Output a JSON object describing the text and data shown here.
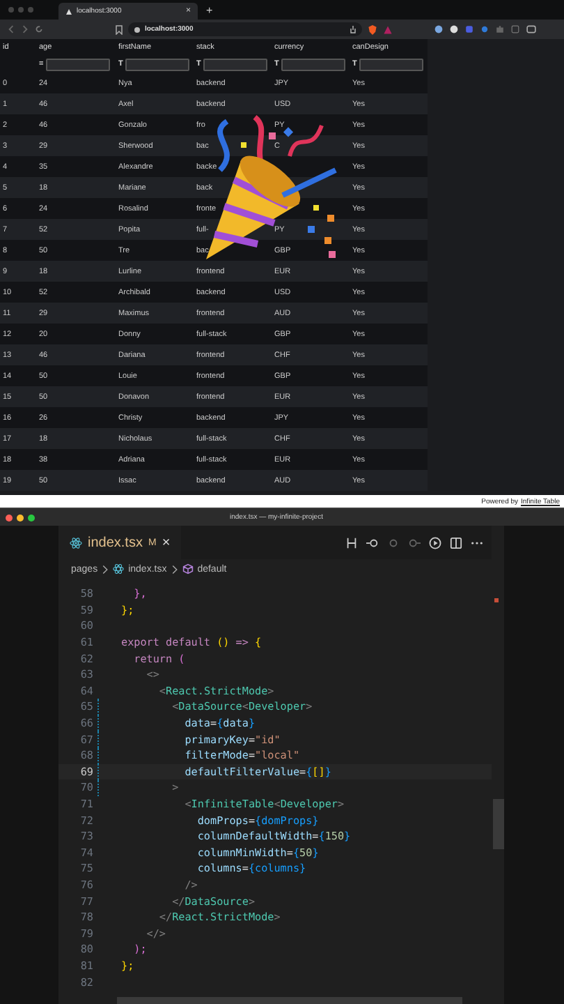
{
  "browser": {
    "tab_title": "localhost:3000",
    "tab_close": "×",
    "new_tab": "+",
    "address": "localhost:3000"
  },
  "table": {
    "columns": [
      "id",
      "age",
      "firstName",
      "stack",
      "currency",
      "canDesign"
    ],
    "filters": [
      {
        "operator": "="
      },
      {
        "operator": "T"
      },
      {
        "operator": "T"
      },
      {
        "operator": "T"
      },
      {
        "operator": "T"
      }
    ],
    "rows": [
      [
        "0",
        "24",
        "Nya",
        "backend",
        "JPY",
        "Yes"
      ],
      [
        "1",
        "46",
        "Axel",
        "backend",
        "USD",
        "Yes"
      ],
      [
        "2",
        "46",
        "Gonzalo",
        "fro",
        "PY",
        "Yes"
      ],
      [
        "3",
        "29",
        "Sherwood",
        "bac",
        "C",
        "Yes"
      ],
      [
        "4",
        "35",
        "Alexandre",
        "backe",
        null,
        "Yes"
      ],
      [
        "5",
        "18",
        "Mariane",
        "back",
        null,
        "Yes"
      ],
      [
        "6",
        "24",
        "Rosalind",
        "fronte",
        null,
        "Yes"
      ],
      [
        "7",
        "52",
        "Popita",
        "full-",
        "PY",
        "Yes"
      ],
      [
        "8",
        "50",
        "Tre",
        "bac",
        "GBP",
        "Yes"
      ],
      [
        "9",
        "18",
        "Lurline",
        "frontend",
        "EUR",
        "Yes"
      ],
      [
        "10",
        "52",
        "Archibald",
        "backend",
        "USD",
        "Yes"
      ],
      [
        "11",
        "29",
        "Maximus",
        "frontend",
        "AUD",
        "Yes"
      ],
      [
        "12",
        "20",
        "Donny",
        "full-stack",
        "GBP",
        "Yes"
      ],
      [
        "13",
        "46",
        "Dariana",
        "frontend",
        "CHF",
        "Yes"
      ],
      [
        "14",
        "50",
        "Louie",
        "frontend",
        "GBP",
        "Yes"
      ],
      [
        "15",
        "50",
        "Donavon",
        "frontend",
        "EUR",
        "Yes"
      ],
      [
        "16",
        "26",
        "Christy",
        "backend",
        "JPY",
        "Yes"
      ],
      [
        "17",
        "18",
        "Nicholaus",
        "full-stack",
        "CHF",
        "Yes"
      ],
      [
        "18",
        "38",
        "Adriana",
        "full-stack",
        "EUR",
        "Yes"
      ],
      [
        "19",
        "50",
        "Issac",
        "backend",
        "AUD",
        "Yes"
      ]
    ],
    "footer_text": "Powered by",
    "footer_link": "Infinite Table"
  },
  "editor": {
    "window_title": "index.tsx — my-infinite-project",
    "tab": {
      "label": "index.tsx",
      "status": "M",
      "close": "×"
    },
    "breadcrumb": [
      "pages",
      "index.tsx",
      "default"
    ],
    "lines": [
      {
        "number": "58",
        "current": false,
        "modified": false,
        "tokens": [
          {
            "t": "  },",
            "kind": "brace2"
          }
        ]
      },
      {
        "number": "59",
        "current": false,
        "modified": false,
        "tokens": [
          {
            "t": "};",
            "kind": "brace"
          }
        ]
      },
      {
        "number": "60",
        "current": false,
        "modified": false
      },
      {
        "number": "61",
        "current": false,
        "modified": false,
        "tokens": [
          {
            "t": "export default ",
            "kind": "kw"
          },
          {
            "t": "() ",
            "kind": "brace"
          },
          {
            "t": "=> ",
            "kind": "kw"
          },
          {
            "t": "{",
            "kind": "brace"
          }
        ]
      },
      {
        "number": "62",
        "current": false,
        "modified": false,
        "tokens": [
          {
            "t": "  return ",
            "kind": "kw"
          },
          {
            "t": "(",
            "kind": "brace2"
          }
        ]
      },
      {
        "number": "63",
        "current": false,
        "modified": false,
        "tokens": [
          {
            "t": "    <>",
            "kind": "punct"
          }
        ]
      },
      {
        "number": "64",
        "current": false,
        "modified": false,
        "tokens": [
          {
            "t": "      <",
            "kind": "punct"
          },
          {
            "t": "React.StrictMode",
            "kind": "tag"
          },
          {
            "t": ">",
            "kind": "punct"
          }
        ]
      },
      {
        "number": "65",
        "current": false,
        "modified": true,
        "tokens": [
          {
            "t": "        <",
            "kind": "punct"
          },
          {
            "t": "DataSource",
            "kind": "tag"
          },
          {
            "t": "<",
            "kind": "punct"
          },
          {
            "t": "Developer",
            "kind": "tag"
          },
          {
            "t": ">",
            "kind": "punct"
          }
        ]
      },
      {
        "number": "66",
        "current": false,
        "modified": true,
        "tokens": [
          {
            "t": "          data",
            "kind": "attr"
          },
          {
            "t": "=",
            "kind": "plain"
          },
          {
            "t": "{",
            "kind": "brace3"
          },
          {
            "t": "data",
            "kind": "attr"
          },
          {
            "t": "}",
            "kind": "brace3"
          }
        ]
      },
      {
        "number": "67",
        "current": false,
        "modified": true,
        "tokens": [
          {
            "t": "          primaryKey",
            "kind": "attr"
          },
          {
            "t": "=",
            "kind": "plain"
          },
          {
            "t": "\"id\"",
            "kind": "str"
          }
        ]
      },
      {
        "number": "68",
        "current": false,
        "modified": true,
        "tokens": [
          {
            "t": "          filterMode",
            "kind": "attr"
          },
          {
            "t": "=",
            "kind": "plain"
          },
          {
            "t": "\"local\"",
            "kind": "str"
          }
        ]
      },
      {
        "number": "69",
        "current": true,
        "modified": true,
        "tokens": [
          {
            "t": "          defaultFilterValue",
            "kind": "attr"
          },
          {
            "t": "=",
            "kind": "plain"
          },
          {
            "t": "{",
            "kind": "brace3"
          },
          {
            "t": "[]",
            "kind": "brace"
          },
          {
            "t": "}",
            "kind": "brace3"
          }
        ]
      },
      {
        "number": "70",
        "current": false,
        "modified": true,
        "tokens": [
          {
            "t": "        >",
            "kind": "punct"
          }
        ]
      },
      {
        "number": "71",
        "current": false,
        "modified": false,
        "tokens": [
          {
            "t": "          <",
            "kind": "punct"
          },
          {
            "t": "InfiniteTable",
            "kind": "tag"
          },
          {
            "t": "<",
            "kind": "punct"
          },
          {
            "t": "Developer",
            "kind": "tag"
          },
          {
            "t": ">",
            "kind": "punct"
          }
        ]
      },
      {
        "number": "72",
        "current": false,
        "modified": false,
        "tokens": [
          {
            "t": "            domProps",
            "kind": "attr"
          },
          {
            "t": "=",
            "kind": "plain"
          },
          {
            "t": "{domProps}",
            "kind": "brace3"
          }
        ]
      },
      {
        "number": "73",
        "current": false,
        "modified": false,
        "tokens": [
          {
            "t": "            columnDefaultWidth",
            "kind": "attr"
          },
          {
            "t": "=",
            "kind": "plain"
          },
          {
            "t": "{",
            "kind": "brace3"
          },
          {
            "t": "150",
            "kind": "num"
          },
          {
            "t": "}",
            "kind": "brace3"
          }
        ]
      },
      {
        "number": "74",
        "current": false,
        "modified": false,
        "tokens": [
          {
            "t": "            columnMinWidth",
            "kind": "attr"
          },
          {
            "t": "=",
            "kind": "plain"
          },
          {
            "t": "{",
            "kind": "brace3"
          },
          {
            "t": "50",
            "kind": "num"
          },
          {
            "t": "}",
            "kind": "brace3"
          }
        ]
      },
      {
        "number": "75",
        "current": false,
        "modified": false,
        "tokens": [
          {
            "t": "            columns",
            "kind": "attr"
          },
          {
            "t": "=",
            "kind": "plain"
          },
          {
            "t": "{columns}",
            "kind": "brace3"
          }
        ]
      },
      {
        "number": "76",
        "current": false,
        "modified": false,
        "tokens": [
          {
            "t": "          />",
            "kind": "punct"
          }
        ]
      },
      {
        "number": "77",
        "current": false,
        "modified": false,
        "tokens": [
          {
            "t": "        </",
            "kind": "punct"
          },
          {
            "t": "DataSource",
            "kind": "tag"
          },
          {
            "t": ">",
            "kind": "punct"
          }
        ]
      },
      {
        "number": "78",
        "current": false,
        "modified": false,
        "tokens": [
          {
            "t": "      </",
            "kind": "punct"
          },
          {
            "t": "React.StrictMode",
            "kind": "tag"
          },
          {
            "t": ">",
            "kind": "punct"
          }
        ]
      },
      {
        "number": "79",
        "current": false,
        "modified": false,
        "tokens": [
          {
            "t": "    </>",
            "kind": "punct"
          }
        ]
      },
      {
        "number": "80",
        "current": false,
        "modified": false,
        "tokens": [
          {
            "t": "  );",
            "kind": "brace2"
          }
        ]
      },
      {
        "number": "81",
        "current": false,
        "modified": false,
        "tokens": [
          {
            "t": "};",
            "kind": "brace"
          }
        ]
      },
      {
        "number": "82",
        "current": false,
        "modified": false
      }
    ]
  }
}
